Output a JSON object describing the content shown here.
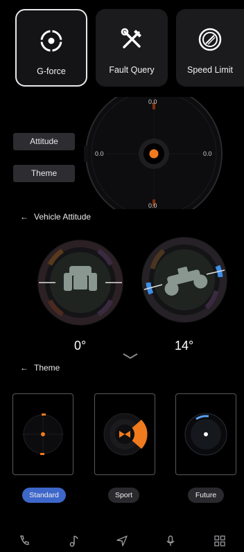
{
  "modes": [
    {
      "label": "G-force",
      "icon": "target-icon",
      "active": true
    },
    {
      "label": "Fault Query",
      "icon": "tools-icon",
      "active": false
    },
    {
      "label": "Speed Limit",
      "icon": "speed-limit-icon",
      "active": false
    }
  ],
  "side_buttons": {
    "attitude": "Attitude",
    "theme": "Theme"
  },
  "gforce": {
    "top": "0.0",
    "left": "0.0",
    "right": "0.0",
    "bottom": "0.0",
    "accent": "#f07a1e"
  },
  "attitude": {
    "title": "Vehicle Attitude",
    "roll": "0°",
    "pitch": "14°"
  },
  "theme": {
    "title": "Theme",
    "options": [
      {
        "label": "Standard",
        "selected": true
      },
      {
        "label": "Sport",
        "selected": false
      },
      {
        "label": "Future",
        "selected": false
      }
    ],
    "selected_color": "#3d67c9"
  },
  "nav": {
    "icons": [
      "phone-icon",
      "music-icon",
      "navigation-icon",
      "microphone-icon",
      "apps-grid-icon"
    ]
  }
}
